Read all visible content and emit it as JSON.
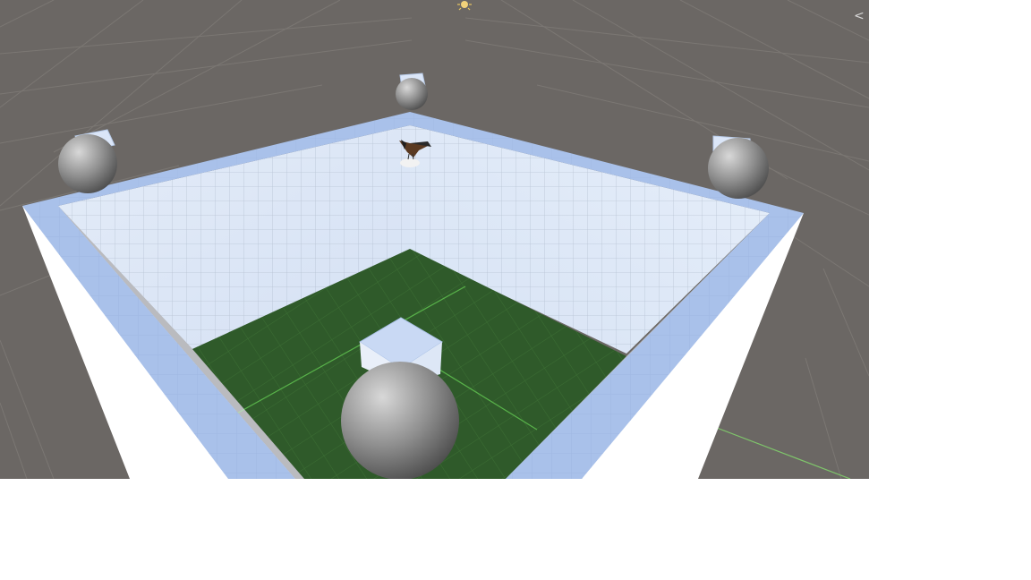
{
  "scene_view": {
    "gizmo_glyph": "<",
    "colors": {
      "background": "#6b6764",
      "ground_grid": "#7f7b77",
      "wall_outer": "#ffffff",
      "wall_top": "#a9c1ea",
      "wall_inner": "#dfe8f7",
      "floor": "#2f5a2a",
      "floor_grid": "#4a9a3e",
      "sphere": "#8a8a8a",
      "cube": "#c8d8f2"
    },
    "objects": [
      {
        "kind": "sphere-with-cube",
        "role": "corner-marker-left"
      },
      {
        "kind": "sphere-with-cube",
        "role": "corner-marker-back"
      },
      {
        "kind": "sphere-with-cube",
        "role": "corner-marker-right"
      },
      {
        "kind": "sphere-with-cube",
        "role": "center-object"
      },
      {
        "kind": "bird-sprite",
        "role": "agent"
      }
    ]
  }
}
